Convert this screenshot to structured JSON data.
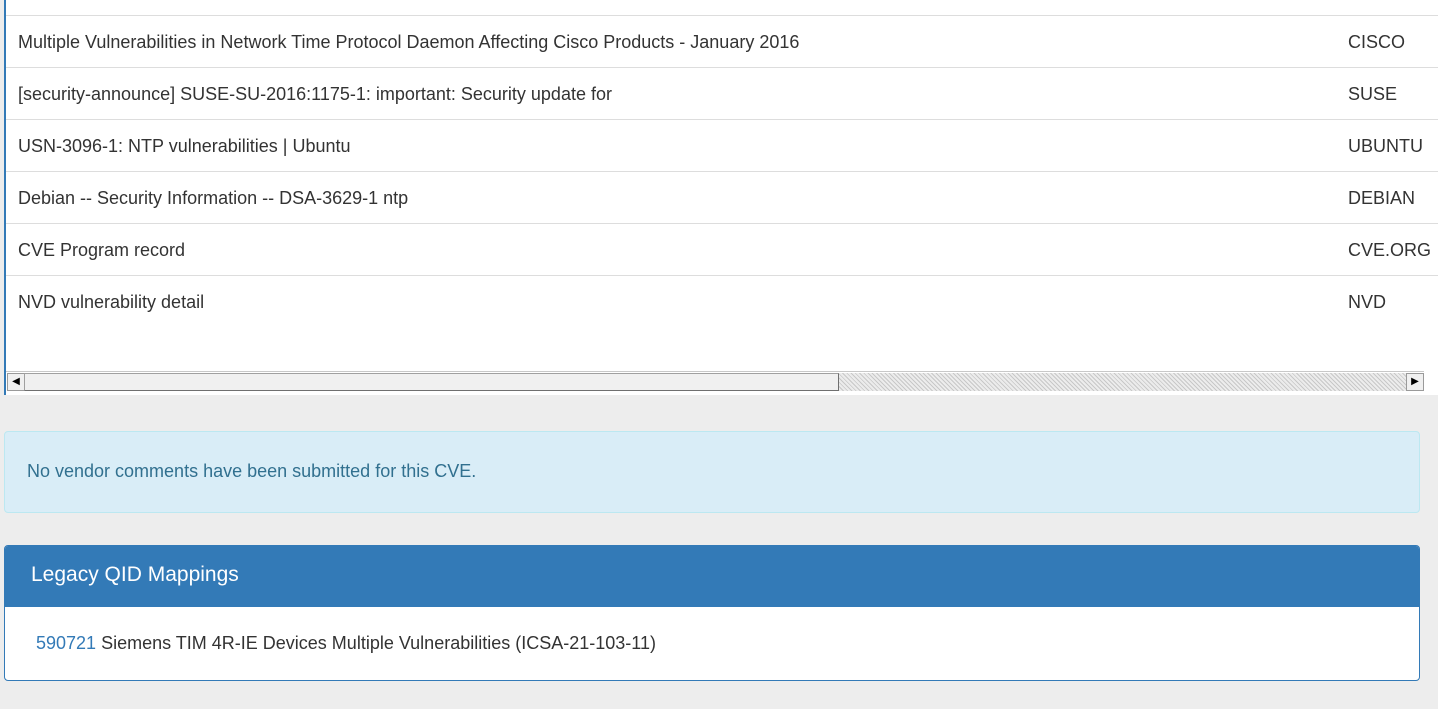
{
  "references": {
    "rows": [
      {
        "title": "Multiple Vulnerabilities in Network Time Protocol Daemon Affecting Cisco Products - January 2016",
        "source": "CISCO"
      },
      {
        "title": "[security-announce] SUSE-SU-2016:1175-1: important: Security update for",
        "source": "SUSE"
      },
      {
        "title": "USN-3096-1: NTP vulnerabilities | Ubuntu",
        "source": "UBUNTU"
      },
      {
        "title": "Debian -- Security Information -- DSA-3629-1 ntp",
        "source": "DEBIAN"
      },
      {
        "title": "CVE Program record",
        "source": "CVE.ORG"
      },
      {
        "title": "NVD vulnerability detail",
        "source": "NVD"
      }
    ],
    "scrollbar": {
      "left_arrow": "◀",
      "right_arrow": "▶",
      "position_fraction": 0.59
    }
  },
  "vendor_comments": {
    "message": "No vendor comments have been submitted for this CVE."
  },
  "legacy_qid": {
    "heading": "Legacy QID Mappings",
    "items": [
      {
        "qid": "590721",
        "description": " Siemens TIM 4R-IE Devices Multiple Vulnerabilities (ICSA-21-103-11)"
      }
    ]
  },
  "colors": {
    "brand_blue": "#337ab7",
    "alert_bg": "#d9edf7",
    "alert_text": "#31708f",
    "page_bg": "#ededed"
  }
}
